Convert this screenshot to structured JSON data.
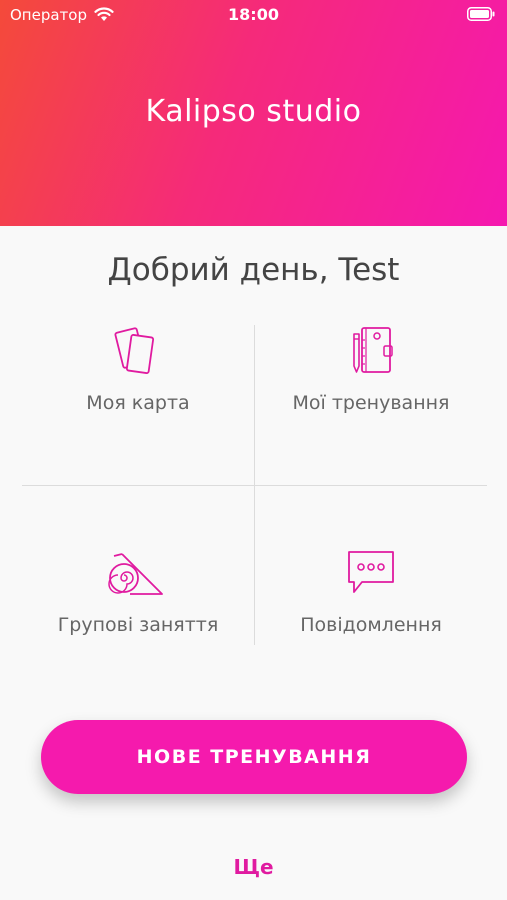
{
  "status_bar": {
    "carrier": "Оператор",
    "time": "18:00"
  },
  "header": {
    "title": "Kalipso studio"
  },
  "greeting": "Добрий день, Test",
  "tiles": [
    {
      "label": "Моя карта",
      "icon": "cards-icon"
    },
    {
      "label": "Мої тренування",
      "icon": "notebook-icon"
    },
    {
      "label": "Групові заняття",
      "icon": "yoga-mat-icon"
    },
    {
      "label": "Повідомлення",
      "icon": "chat-icon"
    }
  ],
  "primary_button": {
    "label": "НОВЕ ТРЕНУВАННЯ"
  },
  "more_link": "Ще",
  "colors": {
    "accent": "#f51aad",
    "gradient_start": "#f44a3a",
    "gradient_end": "#f518b0"
  }
}
